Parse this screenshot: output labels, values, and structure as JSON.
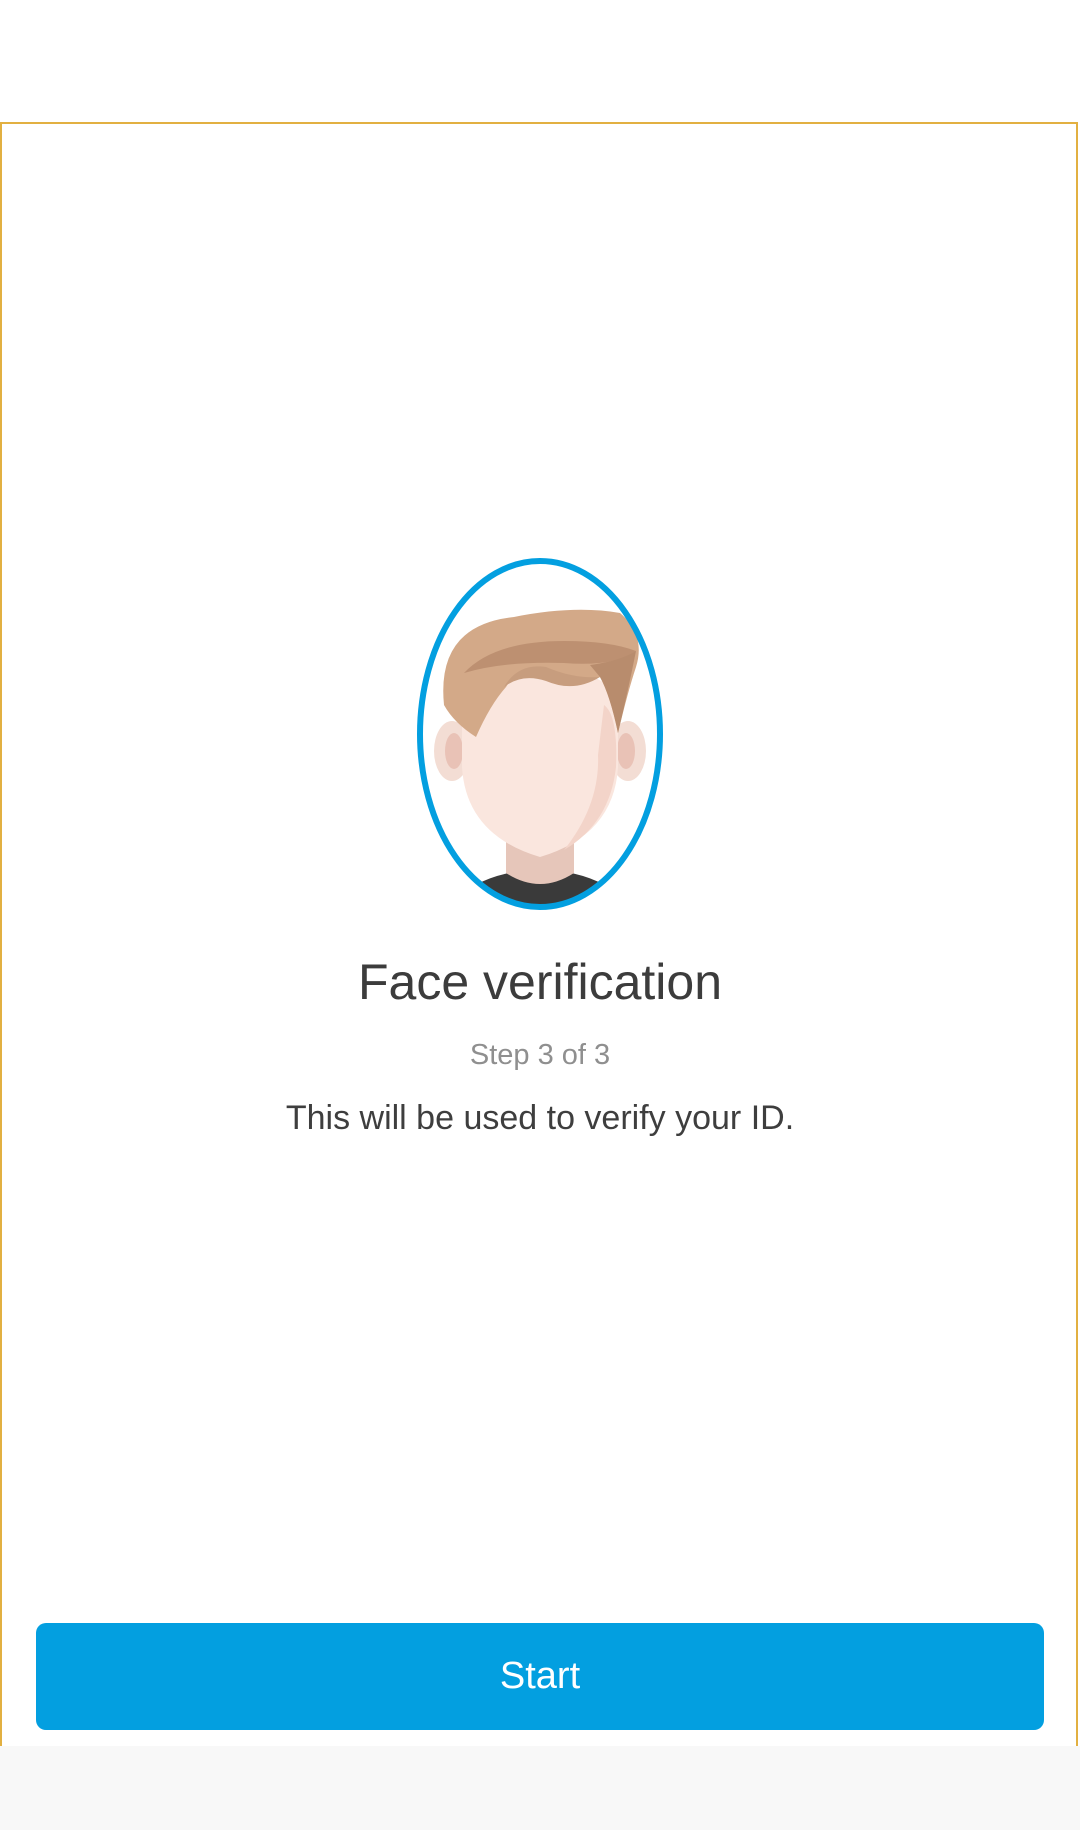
{
  "header": {},
  "illustration": {
    "icon": "face-portrait-icon",
    "oval_color": "#039fe0"
  },
  "content": {
    "title": "Face verification",
    "step": "Step 3 of 3",
    "description": "This will be used to verify your ID."
  },
  "actions": {
    "start_label": "Start",
    "accent": "#039fe0"
  },
  "frame": {
    "border_color": "#e2b041"
  }
}
